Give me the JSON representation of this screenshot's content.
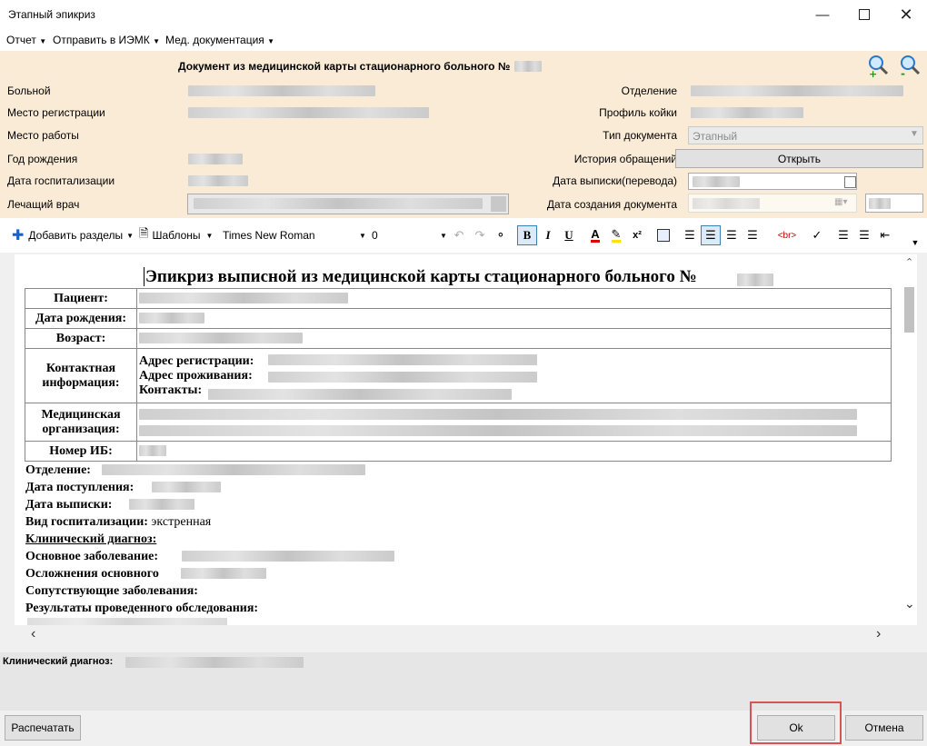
{
  "window": {
    "title": "Этапный эпикриз"
  },
  "menu": [
    {
      "label": "Отчет"
    },
    {
      "label": "Отправить в ИЭМК"
    },
    {
      "label": "Мед. документация"
    }
  ],
  "header": {
    "doc_title": "Документ из медицинской карты стационарного больного №",
    "labels_left": [
      "Больной",
      "Место регистрации",
      "Место работы",
      "Год рождения",
      "Дата госпитализации",
      "Лечащий врач"
    ],
    "labels_right": [
      "Отделение",
      "Профиль койки",
      "Тип документа",
      "История обращений",
      "Дата выписки(перевода)",
      "Дата создания документа"
    ],
    "doc_type_value": "Этапный",
    "open_button": "Открыть"
  },
  "toolbar": {
    "add_sections": "Добавить разделы",
    "templates": "Шаблоны",
    "font_name": "Times New Roman",
    "font_size": "0",
    "bold": "B",
    "italic": "I",
    "underline": "U",
    "superscript": "x²"
  },
  "document": {
    "heading": "Эпикриз выписной из медицинской карты стационарного больного №",
    "table": {
      "patient": "Пациент:",
      "birthdate": "Дата рождения:",
      "age": "Возраст:",
      "contact": "Контактная информация:",
      "address_reg": "Адрес регистрации:",
      "address_live": "Адрес проживания:",
      "contacts": "Контакты:",
      "med_org": "Медицинская организация:",
      "record_no": "Номер ИБ:"
    },
    "lines": {
      "department": "Отделение:",
      "admission_date": "Дата поступления:",
      "discharge_date": "Дата выписки:",
      "hosp_type_label": "Вид госпитализации:",
      "hosp_type_value": "экстренная",
      "clinical_diag": "Клинический диагноз:",
      "main_disease": "Основное заболевание:",
      "complications": "Осложнения основного",
      "comorbid": "Сопутствующие заболевания:",
      "exam_results": "Результаты проведенного обследования:"
    }
  },
  "bottom": {
    "diag_label": "Клинический диагноз:",
    "print_button": "Распечатать",
    "ok_button": "Ok",
    "cancel_button": "Отмена"
  },
  "colors": {
    "header_bg": "#faebd7",
    "ok_highlight": "#d9534f"
  }
}
